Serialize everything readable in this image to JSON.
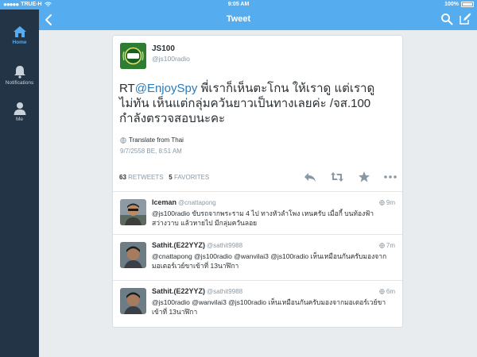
{
  "status_bar": {
    "carrier": "TRUE-H",
    "time": "9:05 AM",
    "battery": "100%"
  },
  "nav": {
    "title": "Tweet"
  },
  "sidebar": {
    "items": [
      {
        "label": "Home",
        "icon": "home-icon"
      },
      {
        "label": "Notifications",
        "icon": "bell-icon"
      },
      {
        "label": "Me",
        "icon": "person-icon"
      }
    ]
  },
  "tweet": {
    "author_name": "JS100",
    "author_handle": "@js100radio",
    "text_rt": "RT",
    "text_mention": "@EnjoySpy",
    "text_body": "พี่เราก็เห็นตะโกน ให้เราดู แต่เราดูไม่ทัน เห็นแต่กลุ่มควันยาวเป็นทางเลยค่ะ /จส.100 กำลังตรวจสอบนะคะ",
    "translate": "Translate from Thai",
    "timestamp": "9/7/2558 BE, 8:51 AM",
    "retweets_count": "63",
    "retweets_label": "RETWEETS",
    "favorites_count": "5",
    "favorites_label": "FAVORITES"
  },
  "replies": [
    {
      "name": "Iceman",
      "handle": "@cnattapong",
      "time": "9m",
      "text": "@js100radio ขับรถจากพระราม 4 ไป ทางหัวลำโพง เหนครับ เมื่อกี้ บนท้องฟ้า สว่างวาบ แล้วหายไป มีกลุ่มควันลอย"
    },
    {
      "name": "Sathit.(E22YYZ)",
      "handle": "@sathit9988",
      "time": "7m",
      "text": "@cnattapong @js100radio @wanvilai3 @js100radio เห็นเหมือนกันครับมองจากมอเตอร์เวย์ขาเข้าที่ 13นาฬิกา"
    },
    {
      "name": "Sathit.(E22YYZ)",
      "handle": "@sathit9988",
      "time": "6m",
      "text": "@js100radio @wanvilai3 @js100radio เห็นเหมือนกันครับมองจากมอเตอร์เวย์ขาเข้าที่ 13นาฬิกา"
    }
  ],
  "colors": {
    "accent": "#55acee",
    "sidebar": "#243447",
    "link": "#2b7bb9",
    "background": "#e9ecef"
  }
}
